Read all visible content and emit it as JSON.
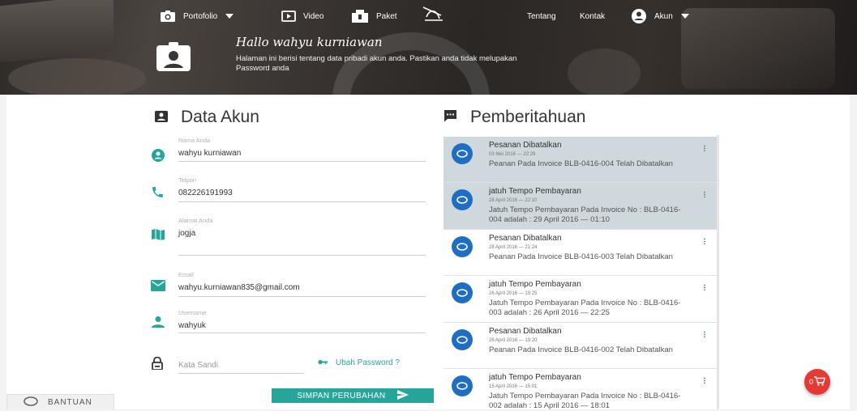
{
  "nav": {
    "portfolio": "Portofolio",
    "video": "Video",
    "paket": "Paket",
    "tentang": "Tentang",
    "kontak": "Kontak",
    "akun": "Akun"
  },
  "hero": {
    "greeting": "Hallo wahyu kurniawan",
    "subtitle": "Halaman ini berisi tentang data pribadi akun anda. Pastikan anda tidak melupakan Password anda"
  },
  "account": {
    "heading": "Data Akun",
    "name_label": "Nama Anda",
    "name_value": "wahyu kurniawan",
    "phone_label": "Telpon",
    "phone_value": "082226191993",
    "address_label": "Alamat Anda",
    "address_value": "jogja",
    "email_label": "Email",
    "email_value": "wahyu.kurniawan835@gmail.com",
    "username_label": "Username",
    "username_value": "wahyuk",
    "password_placeholder": "Kata Sandi",
    "change_password": "Ubah Password ?",
    "save_button": "SIMPAN PERUBAHAN"
  },
  "notifications": {
    "heading": "Pemberitahuan",
    "items": [
      {
        "title": "Pesanan Dibatalkan",
        "date": "03 Mei 2016 — 22:29",
        "body": "Peanan Pada Invoice BLB-0416-004 Telah Dibatalkan"
      },
      {
        "title": "jatuh Tempo Pembayaran",
        "date": "28 April 2016 — 22:10",
        "body": "Jatuh Tempo Pembayaran Pada Invoice No : BLB-0416-004 adalah : 29 April 2016 — 01:10"
      },
      {
        "title": "Pesanan Dibatalkan",
        "date": "28 April 2016 — 21:24",
        "body": "Peanan Pada Invoice BLB-0416-003 Telah Dibatalkan"
      },
      {
        "title": "jatuh Tempo Pembayaran",
        "date": "26 April 2016 — 19:25",
        "body": "Jatuh Tempo Pembayaran Pada Invoice No : BLB-0416-003 adalah : 26 April 2016 — 22:25"
      },
      {
        "title": "Pesanan Dibatalkan",
        "date": "26 April 2016 — 19:20",
        "body": "Peanan Pada Invoice BLB-0416-002 Telah Dibatalkan"
      },
      {
        "title": "jatuh Tempo Pembayaran",
        "date": "15 April 2016 — 15:01",
        "body": "Jatuh Tempo Pembayaran Pada Invoice No : BLB-0416-002 adalah : 15 April 2016 — 18:01"
      }
    ]
  },
  "help": {
    "label": "BANTUAN"
  },
  "cart": {
    "count": "0"
  },
  "colors": {
    "accent": "#26a69a",
    "notif_avatar": "#1e6fc4",
    "unread_bg": "#cfd8dc",
    "cart": "#e53935"
  }
}
